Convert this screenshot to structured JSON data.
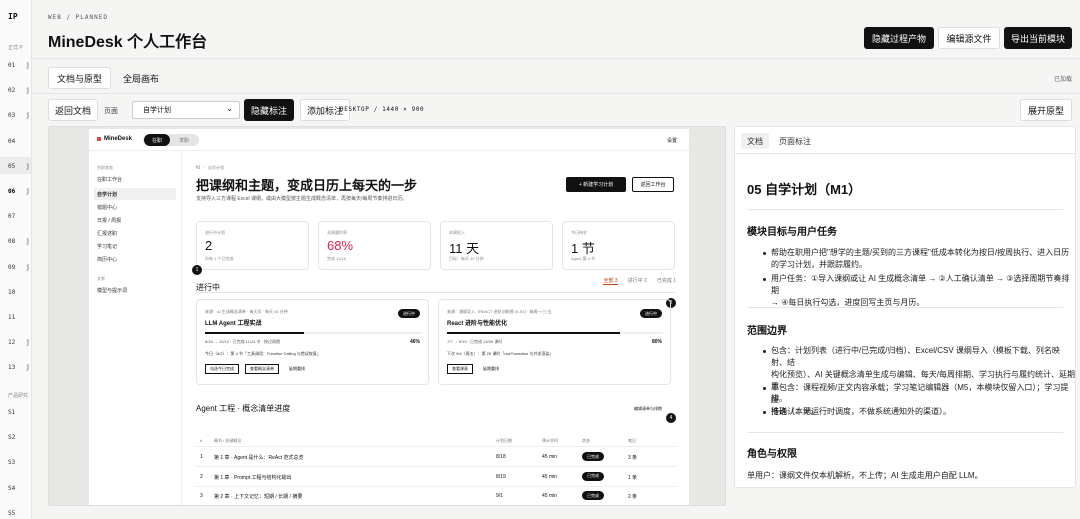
{
  "rail": {
    "logo": "IP",
    "section1": "正式 P",
    "items1": [
      "01",
      "02",
      "03",
      "04",
      "05",
      "06",
      "07",
      "08",
      "09",
      "10",
      "11",
      "12",
      "13"
    ],
    "glyphs": [
      "j",
      "j",
      "j",
      "",
      "j",
      "j",
      "",
      "j",
      "j",
      "",
      "",
      "j",
      "j"
    ],
    "section2": "产品研究",
    "items2": [
      "S1",
      "S2",
      "S3",
      "S4",
      "S5"
    ]
  },
  "header": {
    "breadcrumb": "WEB / PLANNED",
    "title": "MineDesk 个人工作台",
    "hide_artifacts": "隐藏过程产物",
    "edit_source": "编辑源文件",
    "export_module": "导出当前模块"
  },
  "tabs": [
    "文档与原型",
    "全局画布"
  ],
  "loaded_label": "已加载",
  "toolbar": {
    "back_doc": "返回文档",
    "page_label": "页面",
    "page_value": "自学计划",
    "hide_marks": "隐藏标注",
    "add_mark": "添加标注",
    "dims": "DESKTOP / 1440 × 900",
    "expand": "展开原型"
  },
  "app": {
    "brand": "MineDesk",
    "mode_on": "在职",
    "mode_off": "求职",
    "settings": "设置",
    "nav_section1": "在职状态",
    "nav": [
      "在职工作台",
      "自学计划",
      "错题中心",
      "日报 / 周报",
      "汇报述职",
      "学习笔记",
      "简历中心"
    ],
    "nav_section2": "文库",
    "nav_extra": "模型与提示词",
    "kicker": "M1 · 自学计划",
    "heading": "把课纲和主题，变成日历上每天的一步",
    "subtitle": "支持导入三方课程 Excel 课纲，或由大模型按主题生成概念清单，再按每天/每周节奏排进日历。",
    "new_plan": "+ 新建学习计划",
    "back_workspace": "返回工作台",
    "stats": [
      {
        "k": "进行中计划",
        "v": "2",
        "d": "另有 1 个已完成"
      },
      {
        "k": "本周履约率",
        "v": "68%",
        "d": "完成 11/16"
      },
      {
        "k": "本周投入",
        "v": "11 天",
        "d": "目标：每天 45 分钟"
      },
      {
        "k": "今日待学",
        "v": "1 节",
        "d": "Agent 第 4 节"
      }
    ],
    "in_progress": "进行中",
    "filters": [
      "全部 3",
      "进行中 2",
      "已完成 1"
    ],
    "cards": [
      {
        "meta": "来源：AI 生成概念清单 · 每天学 · 每天 45 分钟",
        "title": "LLM Agent 工程实战",
        "status": "进行中",
        "dates": "8/18 → 10/12 · 已完成 11/24 节 · 按过周期",
        "pct": "46%",
        "pct_value": 46,
        "next": "今日（8/2）：第 4 节「工具调用：Function Calling 与错误恢复」",
        "acts": [
          "勾选今日完成",
          "查看概念清单",
          "延期重排"
        ]
      },
      {
        "meta": "来源：课纲导入（REACT 进阶训练营.XLSX）· 每周一/三/五",
        "title": "React 进阶与性能优化",
        "status": "进行中",
        "dates": "7/7 → 9/19 · 已完成 24/30 课时",
        "pct": "80%",
        "pct_value": 80,
        "next": "下次 9/4（周五）：第 25 课时「useTransition 与并发渲染」",
        "acts": [
          "查看课表",
          "延期重排"
        ]
      }
    ],
    "table_title": "Agent 工程 · 概念清单进度",
    "table_link": "编辑清单与排期",
    "columns": [
      "#",
      "章节 / 关键概念",
      "计划日期",
      "预计学时",
      "状态",
      "笔记"
    ],
    "rows": [
      {
        "n": "1",
        "t": "第 1 章 · Agent 是什么：ReAct 范式总览",
        "d": "8/18",
        "h": "45 min",
        "s": "已完成",
        "note": "3 条"
      },
      {
        "n": "2",
        "t": "第 1 章 · Prompt 工程与结构化输出",
        "d": "8/19",
        "h": "45 min",
        "s": "已完成",
        "note": "1 条"
      },
      {
        "n": "3",
        "t": "第 2 章 · 上下文记忆：短期 / 长期 / 摘要",
        "d": "9/1",
        "h": "45 min",
        "s": "已完成",
        "note": "2 条"
      },
      {
        "n": "4",
        "t": "第 2 章 · 工具调用：Function Calling 与错误恢复",
        "d": "9/2 今天",
        "h": "45 min",
        "s": "今日待学",
        "note": "写笔记"
      }
    ],
    "markers": [
      "1",
      "2",
      "3",
      "4"
    ]
  },
  "doc": {
    "tabs": [
      "文档",
      "页面标注"
    ],
    "h1": "05 自学计划（M1）",
    "sec1": "模块目标与用户任务",
    "sec1_p1": [
      "帮助在职用户把\"想学的主题/买到的三方课程\"低成本转化为按日/按周执行、进入日历",
      "的学习计划，并跟踪履约。"
    ],
    "sec1_p2": [
      "用户任务：①导入课纲或让 AI 生成概念清单 → ②人工确认清单 → ③选择周期节奏排期",
      "→ ④每日执行勾选，进度回写主页与月历。"
    ],
    "sec2": "范围边界",
    "sec2_p1": [
      "包含：计划列表（进行中/已完成/归档）、Excel/CSV 课纲导入（模板下载、列名映射、结",
      "构化预览）、AI 关键概念清单生成与编辑、每天/每周排期、学习执行与履约统计、延期重",
      "排。"
    ],
    "sec2_p2": [
      "不包含：课程视频/正文内容承载；学习笔记编辑器（M5，本模块仅留入口）；学习提醒",
      "推送（本地运行时调度，不做系统通知外的渠道）。"
    ],
    "sec2_p3": "待确认：无。",
    "sec3": "角色与权限",
    "sec3_p": "单用户：课纲文件仅本机解析，不上传；AI 生成走用户自配 LLM。"
  }
}
